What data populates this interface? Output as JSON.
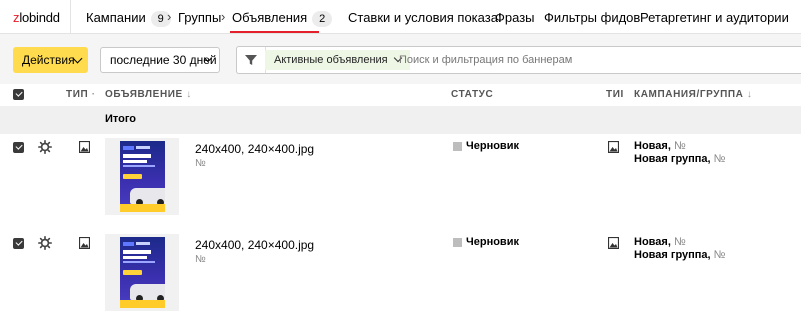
{
  "app": {
    "logo_prefix": "z",
    "logo_rest": "lobindd"
  },
  "breadcrumbs": [
    {
      "label": "Кампании",
      "count": "9"
    },
    {
      "label": "Группы"
    },
    {
      "label": "Объявления",
      "count": "2"
    }
  ],
  "nav_links": [
    "Ставки и условия показа:",
    "Фразы",
    "Фильтры фидов",
    "Ретаргетинг и аудитории"
  ],
  "toolbar": {
    "actions_label": "Действия",
    "period_label": "последние 30 дней",
    "filter_tag": "Активные объявления",
    "search_placeholder": "Поиск и фильтрация по баннерам",
    "search_value": ""
  },
  "table": {
    "columns": {
      "type": "ТИП",
      "ad": "ОБЪЯВЛЕНИЕ",
      "status": "СТАТУС",
      "type2": "ТИІ",
      "campaign": "КАМПАНИЯ/ГРУППА"
    },
    "total_label": "Итого",
    "rows": [
      {
        "name": "240x400, 240×400.jpg",
        "id": "№",
        "status": "Черновик",
        "campaign": "Новая,",
        "campaign_no": "№",
        "group": "Новая группа,",
        "group_no": "№"
      },
      {
        "name": "240x400, 240×400.jpg",
        "id": "№",
        "status": "Черновик",
        "campaign": "Новая,",
        "campaign_no": "№",
        "group": "Новая группа,",
        "group_no": "№"
      }
    ]
  },
  "colors": {
    "accent": "#e5202d",
    "action_button": "#ffdb4d",
    "filter_tag_bg": "#eef7e6",
    "status_draft": "#bdbdbd"
  },
  "icons": [
    "checkbox-icon",
    "gear-icon",
    "image-type-icon",
    "filter-icon",
    "chevron-down-icon"
  ]
}
